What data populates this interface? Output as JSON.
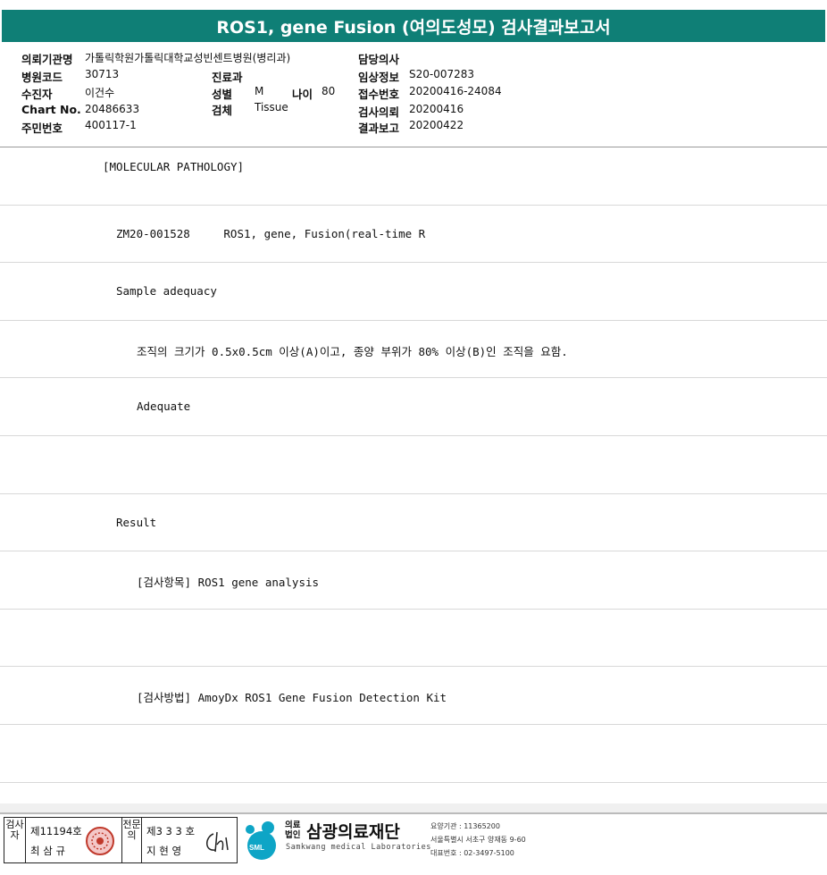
{
  "title": "ROS1, gene Fusion (여의도성모) 검사결과보고서",
  "header": {
    "institution_label": "의뢰기관명",
    "institution_value": "가톨릭학원가톨릭대학교성빈센트병원(병리과)",
    "hospital_code_label": "병원코드",
    "hospital_code_value": "30713",
    "department_label": "진료과",
    "department_value": "",
    "patient_label": "수진자",
    "patient_value": "이건수",
    "sex_label": "성별",
    "sex_value": "M",
    "age_label": "나이",
    "age_value": "80",
    "chart_label": "Chart No.",
    "chart_value": "20486633",
    "specimen_label": "검체",
    "specimen_value": "Tissue",
    "resident_label": "주민번호",
    "resident_value": "400117-1",
    "physician_label": "담당의사",
    "physician_value": "",
    "clinical_label": "임상정보",
    "clinical_value": "S20-007283",
    "receipt_label": "접수번호",
    "receipt_value": "20200416-24084",
    "request_label": "검사의뢰",
    "request_value": "20200416",
    "report_label": "결과보고",
    "report_value": "20200422"
  },
  "rows": [
    {
      "text": "[MOLECULAR PATHOLOGY]"
    },
    {
      "text": "ZM20-001528     ROS1, gene, Fusion(real-time R"
    },
    {
      "text": "Sample adequacy"
    },
    {
      "text": "조직의 크기가 0.5x0.5cm 이상(A)이고, 종양 부위가 80% 이상(B)인 조직을 요함."
    },
    {
      "text": "Adequate"
    },
    {
      "text": ""
    },
    {
      "text": "Result"
    },
    {
      "text": "[검사항목] ROS1 gene analysis"
    },
    {
      "text": ""
    },
    {
      "text": "[검사방법] AmoyDx ROS1 Gene Fusion Detection Kit"
    },
    {
      "text": ""
    }
  ],
  "footer": {
    "examiner_vertical": "검사자",
    "examiner_license": "제11194호",
    "examiner_name": "최 삼 규",
    "specialist_vertical": "전문의",
    "specialist_license": "제3 3 3 호",
    "specialist_name": "지 현 영",
    "org_small": "의료법인",
    "org_name": "삼광의료재단",
    "org_english": "Samkwang medical Laboratories",
    "logo_text": "SML",
    "care_code": "요양기관 : 11365200",
    "address": "서울특별시 서초구 양재동 9-60",
    "phone": "대표번호 : 02-3497-5100"
  }
}
